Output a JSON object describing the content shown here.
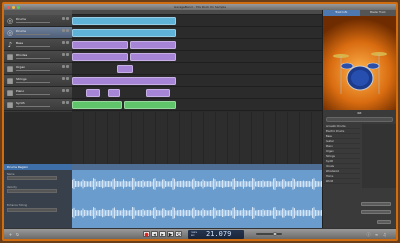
{
  "window": {
    "title": "GarageBand - 70s Rock 01 Sample"
  },
  "tracks": [
    {
      "name": "Drums",
      "icon": "drum-icon",
      "selected": false
    },
    {
      "name": "Drums",
      "icon": "drum-icon",
      "selected": true
    },
    {
      "name": "Bass",
      "icon": "guitar-icon",
      "selected": false
    },
    {
      "name": "Rhodes",
      "icon": "keyboard-icon",
      "selected": false
    },
    {
      "name": "Organ",
      "icon": "keyboard-icon",
      "selected": false
    },
    {
      "name": "Strings",
      "icon": "keyboard-icon",
      "selected": false
    },
    {
      "name": "Piano",
      "icon": "keyboard-icon",
      "selected": false
    },
    {
      "name": "Synth",
      "icon": "keyboard-icon",
      "selected": false
    },
    {
      "name": "Lead Guitar",
      "icon": "guitar-icon",
      "selected": false
    }
  ],
  "editor": {
    "title": "Drums Region",
    "fields": [
      {
        "label": "Name"
      },
      {
        "label": "Velocity"
      },
      {
        "label": "Enhance Timing"
      }
    ]
  },
  "library": {
    "tabs": [
      "Track Info",
      "Master Track"
    ],
    "kit_name": "Kit",
    "search_placeholder": "Search",
    "items": [
      "Acoustic Drums",
      "Electric Drums",
      "Bass",
      "Guitar",
      "Piano",
      "Organ",
      "Strings",
      "Synth",
      "Vocals",
      "Woodwind",
      "Horns",
      "World"
    ]
  },
  "lcd": {
    "time": "21.079",
    "meta_top": "TEMPO",
    "meta_bottom": "KEY"
  },
  "colors": {
    "cyan": "#5fb3d9",
    "purple": "#a785d6",
    "green": "#5fc46a",
    "window_frame": "#d06d10"
  }
}
